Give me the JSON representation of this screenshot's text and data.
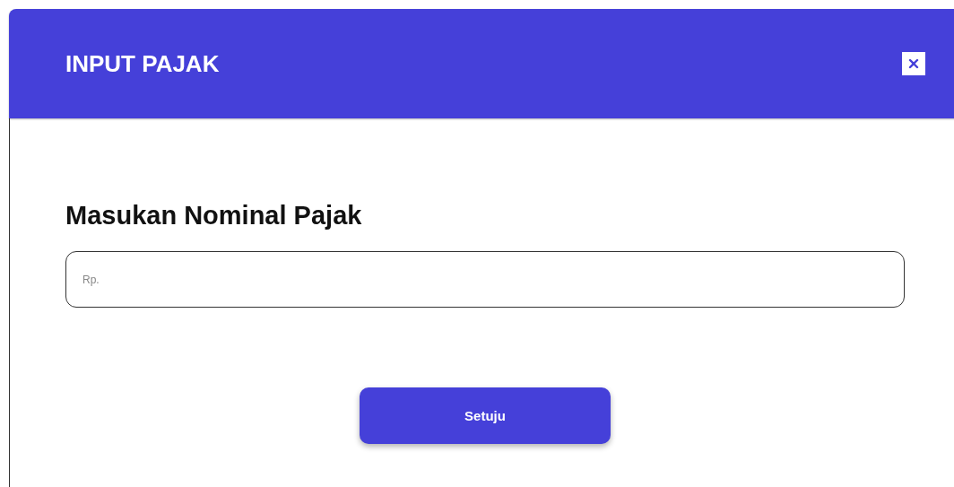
{
  "dialog": {
    "title": "INPUT PAJAK",
    "heading": "Masukan Nominal Pajak",
    "input": {
      "placeholder": "Rp."
    },
    "buttons": [
      "Setuju"
    ]
  }
}
